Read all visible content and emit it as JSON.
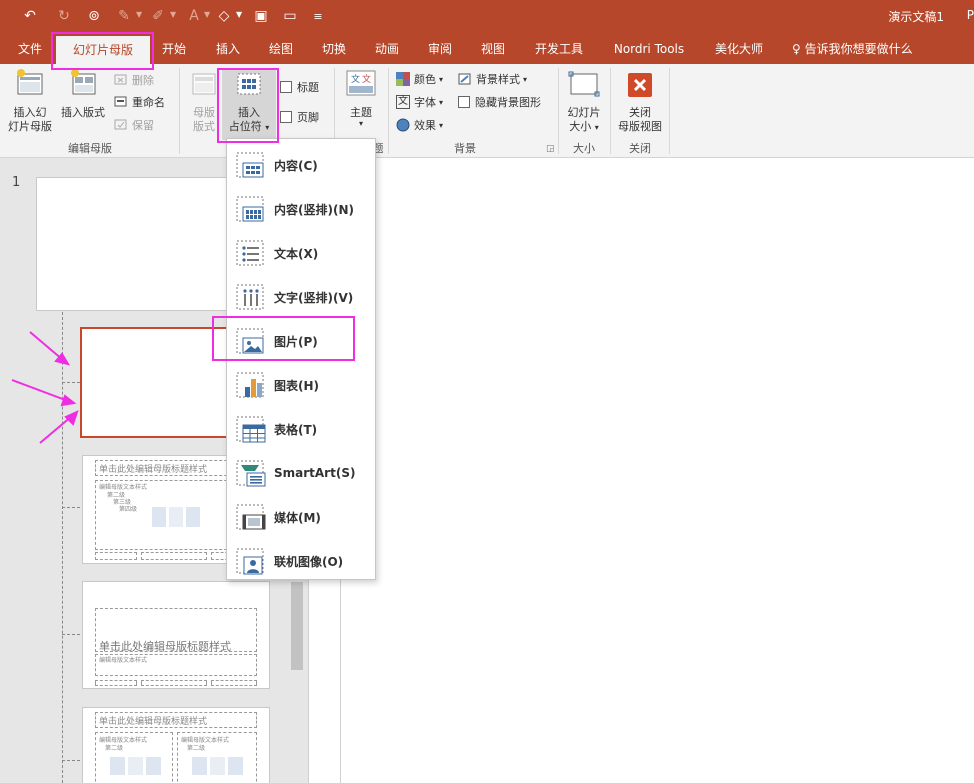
{
  "titlebar": {
    "doc_title": "演示文稿1",
    "doc_title_cut": "P",
    "quick_access": [
      {
        "icon": "undo-icon",
        "glyph": "↶"
      },
      {
        "icon": "redo-icon",
        "glyph": "↻"
      },
      {
        "icon": "presenter-icon",
        "glyph": "⊚"
      },
      {
        "icon": "paint-icon",
        "glyph": "✎"
      },
      {
        "icon": "pen-icon",
        "glyph": "✐"
      },
      {
        "icon": "font-color-icon",
        "glyph": "A"
      },
      {
        "icon": "shape-icon",
        "glyph": "◇"
      },
      {
        "icon": "save-icon",
        "glyph": "▣"
      },
      {
        "icon": "open-icon",
        "glyph": "▭"
      },
      {
        "icon": "customize-icon",
        "glyph": "≡"
      }
    ]
  },
  "tabs": [
    {
      "label": "文件"
    },
    {
      "label": "幻灯片母版"
    },
    {
      "label": "开始"
    },
    {
      "label": "插入"
    },
    {
      "label": "绘图"
    },
    {
      "label": "切换"
    },
    {
      "label": "动画"
    },
    {
      "label": "审阅"
    },
    {
      "label": "视图"
    },
    {
      "label": "开发工具"
    },
    {
      "label": "Nordri Tools"
    },
    {
      "label": "美化大师"
    }
  ],
  "tell_me": "告诉我你想要做什么",
  "ribbon": {
    "insert_master": "插入幻灯片母版",
    "insert_master_l1": "插入幻",
    "insert_master_l2": "灯片母版",
    "insert_layout": "插入版式",
    "delete": "删除",
    "rename": "重命名",
    "preserve": "保留",
    "group_edit_master": "编辑母版",
    "master_layout_l1": "母版",
    "master_layout_l2": "版式",
    "insert_placeholder_l1": "插入",
    "insert_placeholder_l2": "占位符",
    "title_check": "标题",
    "footer_check": "页脚",
    "theme": "主题",
    "group_edit_theme_cut": "题",
    "colors": "颜色",
    "fonts": "字体",
    "effects": "效果",
    "bg_styles": "背景样式",
    "hide_bg": "隐藏背景图形",
    "group_background": "背景",
    "slide_size_l1": "幻灯片",
    "slide_size_l2": "大小",
    "group_size": "大小",
    "close_l1": "关闭",
    "close_l2": "母版视图",
    "group_close": "关闭"
  },
  "slides": {
    "number": "1",
    "layout_title": "单击此处编辑母版标题样式",
    "layout_text": "编辑母版文本样式",
    "level2": "第二级",
    "level3": "第三级",
    "level4": "第四级"
  },
  "menu": {
    "items": [
      {
        "label": "内容(C)",
        "icon": "content-placeholder-icon"
      },
      {
        "label": "内容(竖排)(N)",
        "icon": "content-vertical-placeholder-icon"
      },
      {
        "label": "文本(X)",
        "icon": "text-placeholder-icon"
      },
      {
        "label": "文字(竖排)(V)",
        "icon": "text-vertical-placeholder-icon"
      },
      {
        "label": "图片(P)",
        "icon": "picture-placeholder-icon"
      },
      {
        "label": "图表(H)",
        "icon": "chart-placeholder-icon"
      },
      {
        "label": "表格(T)",
        "icon": "table-placeholder-icon"
      },
      {
        "label": "SmartArt(S)",
        "icon": "smartart-placeholder-icon"
      },
      {
        "label": "媒体(M)",
        "icon": "media-placeholder-icon"
      },
      {
        "label": "联机图像(O)",
        "icon": "online-image-placeholder-icon"
      }
    ]
  },
  "colors": {
    "accent": "#b7472a",
    "highlight": "#ee2ee2",
    "selected_border": "#c8472a"
  }
}
